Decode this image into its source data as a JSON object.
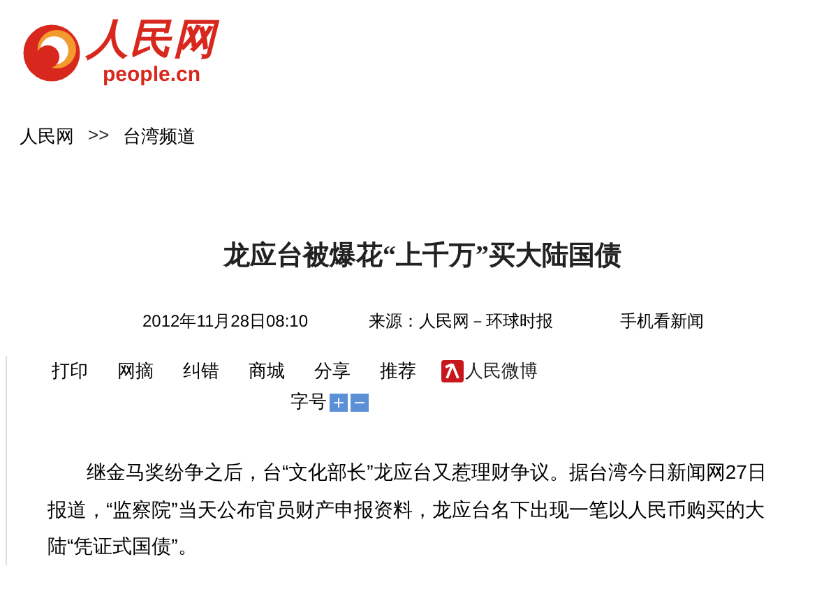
{
  "logo": {
    "name": "人民网",
    "domain": "people.cn"
  },
  "breadcrumb": [
    {
      "label": "人民网"
    },
    {
      "label": ">>",
      "kind": "separator"
    },
    {
      "label": "台湾频道"
    }
  ],
  "article": {
    "title": "龙应台被爆花“上千万”买大陆国债",
    "meta": [
      {
        "text": "2012年11月28日08:10"
      },
      {
        "text": "来源：人民网－环球时报"
      },
      {
        "text": "手机看新闻"
      }
    ],
    "toolbar": [
      {
        "label": "打印"
      },
      {
        "label": "网摘"
      },
      {
        "label": "纠错"
      },
      {
        "label": "商城"
      },
      {
        "label": "分享"
      },
      {
        "label": "推荐"
      },
      {
        "label": "人民微博",
        "kind": "weibo"
      }
    ],
    "font_size": {
      "label": "字号",
      "buttons": [
        "+",
        "−"
      ]
    },
    "paragraphs": [
      "继金马奖纷争之后，台“文化部长”龙应台又惹理财争议。据台湾今日新闻网27日报道，“监察院”当天公布官员财产申报资料，龙应台名下出现一笔以人民币购买的大陆“凭证式国债”。"
    ]
  }
}
